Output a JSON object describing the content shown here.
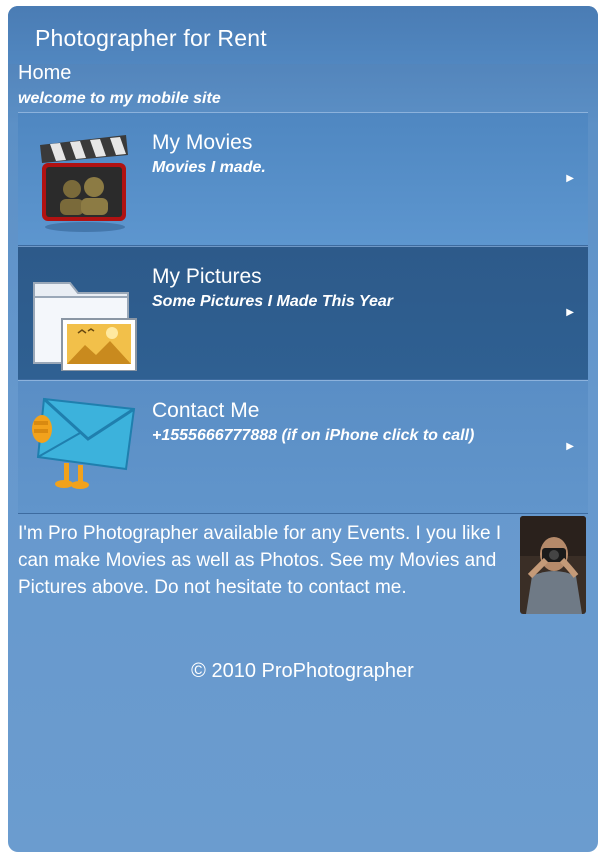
{
  "header": {
    "title": "Photographer for Rent"
  },
  "breadcrumb": {
    "label": "Home",
    "tagline": "welcome to my mobile site"
  },
  "menu": {
    "items": [
      {
        "title": "My Movies",
        "subtitle": "Movies I made.",
        "icon": "film-clapper-icon"
      },
      {
        "title": "My Pictures",
        "subtitle": "Some Pictures I Made This Year",
        "icon": "picture-folder-icon"
      },
      {
        "title": "Contact Me",
        "subtitle": "+1555666777888 (if on iPhone click to call)",
        "icon": "envelope-mail-icon"
      }
    ]
  },
  "about": {
    "text": "I'm Pro Photographer available for any Events. I you like I can make Movies as well as Photos. See my Movies and Pictures above. Do not hesitate to contact me."
  },
  "footer": {
    "text": "© 2010 ProPhotographer"
  },
  "colors": {
    "background": "#6698cd",
    "header": "#4a7cb4",
    "active_item": "#2d5a8a"
  }
}
